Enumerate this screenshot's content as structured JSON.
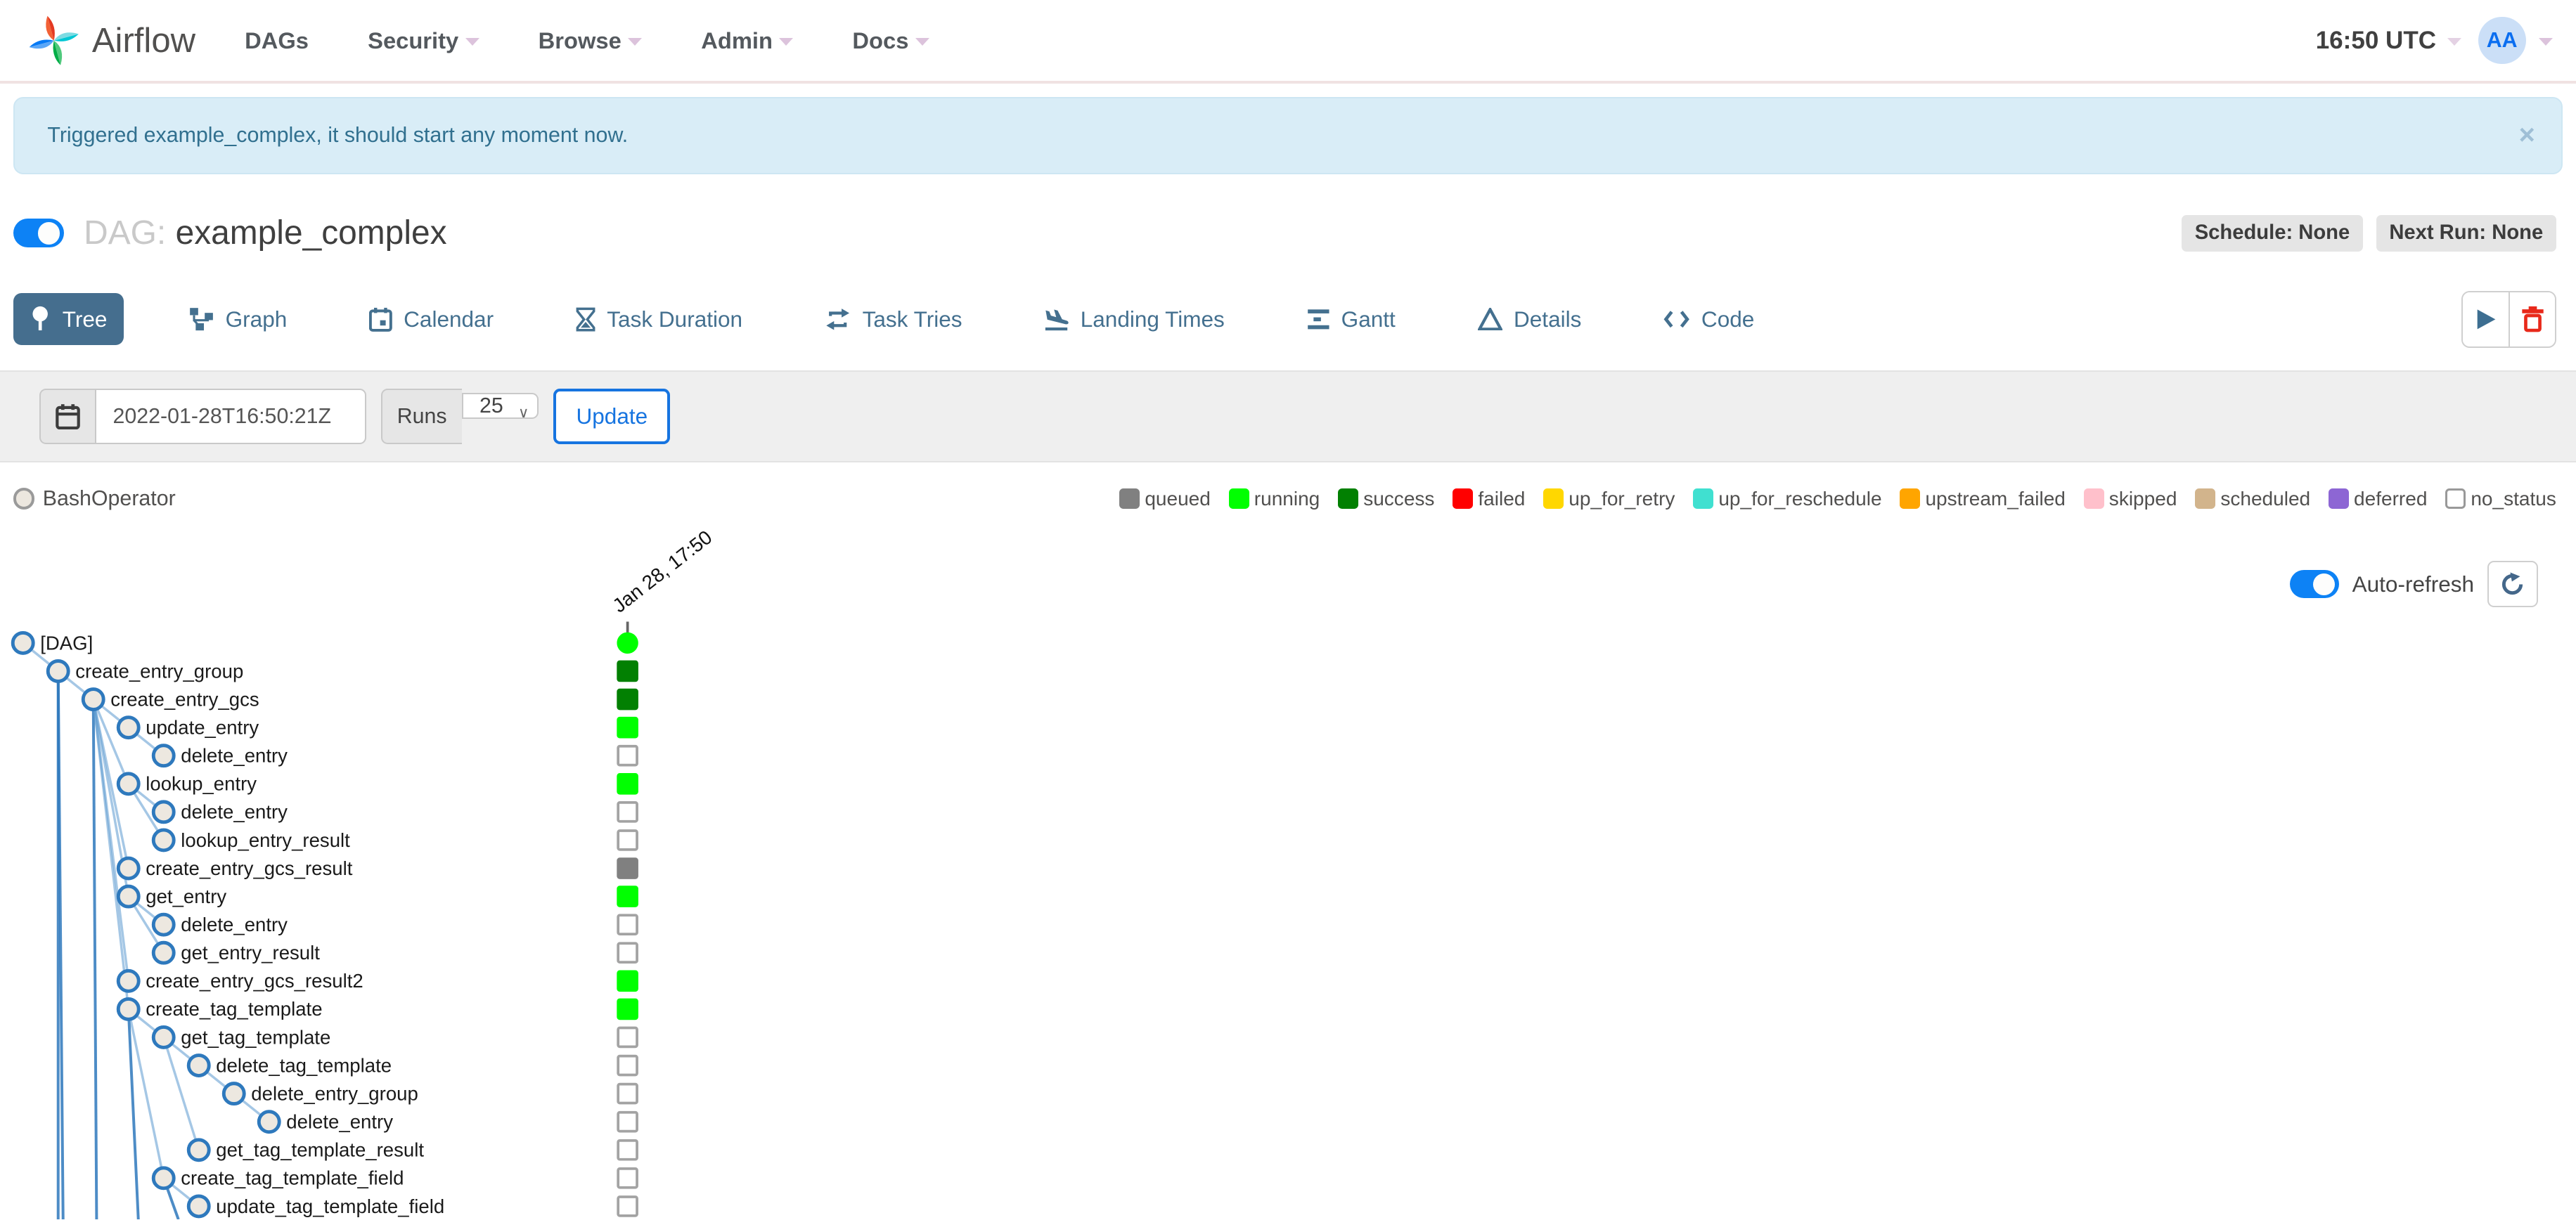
{
  "navbar": {
    "brand": "Airflow",
    "items": [
      {
        "label": "DAGs",
        "caret": false
      },
      {
        "label": "Security",
        "caret": true
      },
      {
        "label": "Browse",
        "caret": true
      },
      {
        "label": "Admin",
        "caret": true
      },
      {
        "label": "Docs",
        "caret": true
      }
    ],
    "clock": "16:50 UTC",
    "avatar_initials": "AA"
  },
  "alert": {
    "message": "Triggered example_complex, it should start any moment now.",
    "close_glyph": "×"
  },
  "dag_header": {
    "prefix": "DAG:",
    "name": "example_complex",
    "badges": [
      {
        "label": "Schedule: None"
      },
      {
        "label": "Next Run: None"
      }
    ]
  },
  "tabs": [
    {
      "label": "Tree",
      "icon": "tree-icon",
      "active": true
    },
    {
      "label": "Graph",
      "icon": "graph-icon",
      "active": false
    },
    {
      "label": "Calendar",
      "icon": "calendar-icon",
      "active": false
    },
    {
      "label": "Task Duration",
      "icon": "hourglass-icon",
      "active": false
    },
    {
      "label": "Task Tries",
      "icon": "retry-arrows-icon",
      "active": false
    },
    {
      "label": "Landing Times",
      "icon": "plane-landing-icon",
      "active": false
    },
    {
      "label": "Gantt",
      "icon": "gantt-bars-icon",
      "active": false
    },
    {
      "label": "Details",
      "icon": "triangle-icon",
      "active": false
    },
    {
      "label": "Code",
      "icon": "code-brackets-icon",
      "active": false
    }
  ],
  "filter": {
    "date_value": "2022-01-28T16:50:21Z",
    "runs_label": "Runs",
    "runs_value": "25",
    "update_label": "Update"
  },
  "legend": {
    "operators": [
      {
        "label": "BashOperator",
        "fill": "#ece7df",
        "border": "#9a9a9a"
      }
    ],
    "statuses": [
      {
        "label": "queued",
        "color": "#808080",
        "border": "#808080"
      },
      {
        "label": "running",
        "color": "#01FF01",
        "border": "#01FF01"
      },
      {
        "label": "success",
        "color": "#028002",
        "border": "#028002"
      },
      {
        "label": "failed",
        "color": "#FF0000",
        "border": "#FF0000"
      },
      {
        "label": "up_for_retry",
        "color": "#FFD700",
        "border": "#FFD700"
      },
      {
        "label": "up_for_reschedule",
        "color": "#40E0D0",
        "border": "#40E0D0"
      },
      {
        "label": "upstream_failed",
        "color": "#FFA500",
        "border": "#FFA500"
      },
      {
        "label": "skipped",
        "color": "#FFC0CB",
        "border": "#FFC0CB"
      },
      {
        "label": "scheduled",
        "color": "#D2B48C",
        "border": "#D2B48C"
      },
      {
        "label": "deferred",
        "color": "#8D66D4",
        "border": "#8D66D4"
      },
      {
        "label": "no_status",
        "color": "#FFFFFF",
        "border": "#999999"
      }
    ]
  },
  "tree": {
    "auto_refresh_label": "Auto-refresh",
    "run_column_label": "Jan 28, 17:50",
    "node_fill": "#ede8e0",
    "node_stroke": "#2e79bd",
    "rows": [
      {
        "label": "[DAG]",
        "level": 0,
        "status": "running",
        "shape": "circle"
      },
      {
        "label": "create_entry_group",
        "level": 1,
        "status": "success",
        "shape": "square"
      },
      {
        "label": "create_entry_gcs",
        "level": 2,
        "status": "success",
        "shape": "square"
      },
      {
        "label": "update_entry",
        "level": 3,
        "status": "running",
        "shape": "square"
      },
      {
        "label": "delete_entry",
        "level": 4,
        "status": "no_status",
        "shape": "square"
      },
      {
        "label": "lookup_entry",
        "level": 3,
        "status": "running",
        "shape": "square"
      },
      {
        "label": "delete_entry",
        "level": 4,
        "status": "no_status",
        "shape": "square"
      },
      {
        "label": "lookup_entry_result",
        "level": 4,
        "status": "no_status",
        "shape": "square"
      },
      {
        "label": "create_entry_gcs_result",
        "level": 3,
        "status": "queued",
        "shape": "square"
      },
      {
        "label": "get_entry",
        "level": 3,
        "status": "running",
        "shape": "square"
      },
      {
        "label": "delete_entry",
        "level": 4,
        "status": "no_status",
        "shape": "square"
      },
      {
        "label": "get_entry_result",
        "level": 4,
        "status": "no_status",
        "shape": "square"
      },
      {
        "label": "create_entry_gcs_result2",
        "level": 3,
        "status": "running",
        "shape": "square"
      },
      {
        "label": "create_tag_template",
        "level": 3,
        "status": "running",
        "shape": "square"
      },
      {
        "label": "get_tag_template",
        "level": 4,
        "status": "no_status",
        "shape": "square"
      },
      {
        "label": "delete_tag_template",
        "level": 5,
        "status": "no_status",
        "shape": "square"
      },
      {
        "label": "delete_entry_group",
        "level": 6,
        "status": "no_status",
        "shape": "square"
      },
      {
        "label": "delete_entry",
        "level": 7,
        "status": "no_status",
        "shape": "square"
      },
      {
        "label": "get_tag_template_result",
        "level": 5,
        "status": "no_status",
        "shape": "square"
      },
      {
        "label": "create_tag_template_field",
        "level": 4,
        "status": "no_status",
        "shape": "square"
      },
      {
        "label": "update_tag_template_field",
        "level": 5,
        "status": "no_status",
        "shape": "square"
      }
    ]
  }
}
